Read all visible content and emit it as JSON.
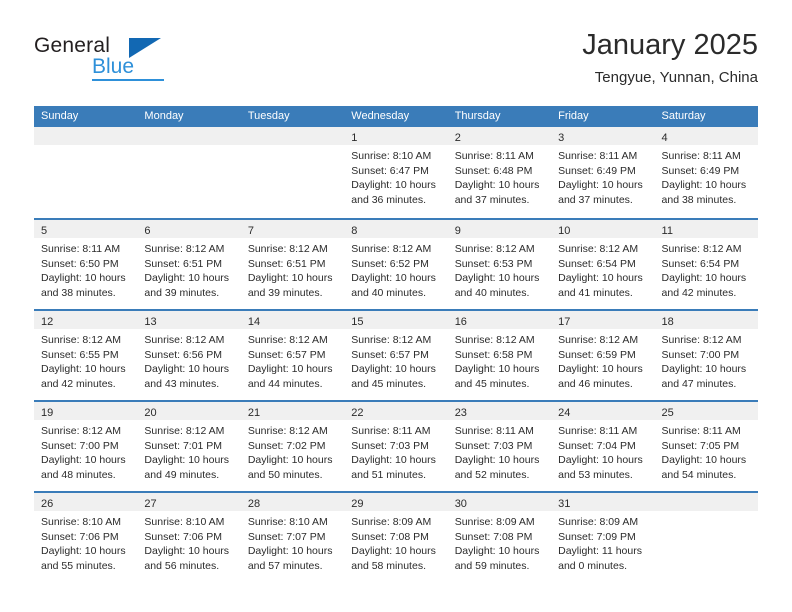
{
  "brand": {
    "name_part1": "General",
    "name_part2": "Blue",
    "triangle_icon": "triangle-icon",
    "accent_color": "#2e90d9",
    "triangle_color": "#1268b3"
  },
  "header": {
    "month_title": "January 2025",
    "location": "Tengyue, Yunnan, China",
    "header_bg_color": "#3a7cb9",
    "day_strip_color": "#f0f0f0"
  },
  "weekdays": [
    "Sunday",
    "Monday",
    "Tuesday",
    "Wednesday",
    "Thursday",
    "Friday",
    "Saturday"
  ],
  "weeks": [
    [
      {
        "day": "",
        "lines": []
      },
      {
        "day": "",
        "lines": []
      },
      {
        "day": "",
        "lines": []
      },
      {
        "day": "1",
        "lines": [
          "Sunrise: 8:10 AM",
          "Sunset: 6:47 PM",
          "Daylight: 10 hours",
          "and 36 minutes."
        ]
      },
      {
        "day": "2",
        "lines": [
          "Sunrise: 8:11 AM",
          "Sunset: 6:48 PM",
          "Daylight: 10 hours",
          "and 37 minutes."
        ]
      },
      {
        "day": "3",
        "lines": [
          "Sunrise: 8:11 AM",
          "Sunset: 6:49 PM",
          "Daylight: 10 hours",
          "and 37 minutes."
        ]
      },
      {
        "day": "4",
        "lines": [
          "Sunrise: 8:11 AM",
          "Sunset: 6:49 PM",
          "Daylight: 10 hours",
          "and 38 minutes."
        ]
      }
    ],
    [
      {
        "day": "5",
        "lines": [
          "Sunrise: 8:11 AM",
          "Sunset: 6:50 PM",
          "Daylight: 10 hours",
          "and 38 minutes."
        ]
      },
      {
        "day": "6",
        "lines": [
          "Sunrise: 8:12 AM",
          "Sunset: 6:51 PM",
          "Daylight: 10 hours",
          "and 39 minutes."
        ]
      },
      {
        "day": "7",
        "lines": [
          "Sunrise: 8:12 AM",
          "Sunset: 6:51 PM",
          "Daylight: 10 hours",
          "and 39 minutes."
        ]
      },
      {
        "day": "8",
        "lines": [
          "Sunrise: 8:12 AM",
          "Sunset: 6:52 PM",
          "Daylight: 10 hours",
          "and 40 minutes."
        ]
      },
      {
        "day": "9",
        "lines": [
          "Sunrise: 8:12 AM",
          "Sunset: 6:53 PM",
          "Daylight: 10 hours",
          "and 40 minutes."
        ]
      },
      {
        "day": "10",
        "lines": [
          "Sunrise: 8:12 AM",
          "Sunset: 6:54 PM",
          "Daylight: 10 hours",
          "and 41 minutes."
        ]
      },
      {
        "day": "11",
        "lines": [
          "Sunrise: 8:12 AM",
          "Sunset: 6:54 PM",
          "Daylight: 10 hours",
          "and 42 minutes."
        ]
      }
    ],
    [
      {
        "day": "12",
        "lines": [
          "Sunrise: 8:12 AM",
          "Sunset: 6:55 PM",
          "Daylight: 10 hours",
          "and 42 minutes."
        ]
      },
      {
        "day": "13",
        "lines": [
          "Sunrise: 8:12 AM",
          "Sunset: 6:56 PM",
          "Daylight: 10 hours",
          "and 43 minutes."
        ]
      },
      {
        "day": "14",
        "lines": [
          "Sunrise: 8:12 AM",
          "Sunset: 6:57 PM",
          "Daylight: 10 hours",
          "and 44 minutes."
        ]
      },
      {
        "day": "15",
        "lines": [
          "Sunrise: 8:12 AM",
          "Sunset: 6:57 PM",
          "Daylight: 10 hours",
          "and 45 minutes."
        ]
      },
      {
        "day": "16",
        "lines": [
          "Sunrise: 8:12 AM",
          "Sunset: 6:58 PM",
          "Daylight: 10 hours",
          "and 45 minutes."
        ]
      },
      {
        "day": "17",
        "lines": [
          "Sunrise: 8:12 AM",
          "Sunset: 6:59 PM",
          "Daylight: 10 hours",
          "and 46 minutes."
        ]
      },
      {
        "day": "18",
        "lines": [
          "Sunrise: 8:12 AM",
          "Sunset: 7:00 PM",
          "Daylight: 10 hours",
          "and 47 minutes."
        ]
      }
    ],
    [
      {
        "day": "19",
        "lines": [
          "Sunrise: 8:12 AM",
          "Sunset: 7:00 PM",
          "Daylight: 10 hours",
          "and 48 minutes."
        ]
      },
      {
        "day": "20",
        "lines": [
          "Sunrise: 8:12 AM",
          "Sunset: 7:01 PM",
          "Daylight: 10 hours",
          "and 49 minutes."
        ]
      },
      {
        "day": "21",
        "lines": [
          "Sunrise: 8:12 AM",
          "Sunset: 7:02 PM",
          "Daylight: 10 hours",
          "and 50 minutes."
        ]
      },
      {
        "day": "22",
        "lines": [
          "Sunrise: 8:11 AM",
          "Sunset: 7:03 PM",
          "Daylight: 10 hours",
          "and 51 minutes."
        ]
      },
      {
        "day": "23",
        "lines": [
          "Sunrise: 8:11 AM",
          "Sunset: 7:03 PM",
          "Daylight: 10 hours",
          "and 52 minutes."
        ]
      },
      {
        "day": "24",
        "lines": [
          "Sunrise: 8:11 AM",
          "Sunset: 7:04 PM",
          "Daylight: 10 hours",
          "and 53 minutes."
        ]
      },
      {
        "day": "25",
        "lines": [
          "Sunrise: 8:11 AM",
          "Sunset: 7:05 PM",
          "Daylight: 10 hours",
          "and 54 minutes."
        ]
      }
    ],
    [
      {
        "day": "26",
        "lines": [
          "Sunrise: 8:10 AM",
          "Sunset: 7:06 PM",
          "Daylight: 10 hours",
          "and 55 minutes."
        ]
      },
      {
        "day": "27",
        "lines": [
          "Sunrise: 8:10 AM",
          "Sunset: 7:06 PM",
          "Daylight: 10 hours",
          "and 56 minutes."
        ]
      },
      {
        "day": "28",
        "lines": [
          "Sunrise: 8:10 AM",
          "Sunset: 7:07 PM",
          "Daylight: 10 hours",
          "and 57 minutes."
        ]
      },
      {
        "day": "29",
        "lines": [
          "Sunrise: 8:09 AM",
          "Sunset: 7:08 PM",
          "Daylight: 10 hours",
          "and 58 minutes."
        ]
      },
      {
        "day": "30",
        "lines": [
          "Sunrise: 8:09 AM",
          "Sunset: 7:08 PM",
          "Daylight: 10 hours",
          "and 59 minutes."
        ]
      },
      {
        "day": "31",
        "lines": [
          "Sunrise: 8:09 AM",
          "Sunset: 7:09 PM",
          "Daylight: 11 hours",
          "and 0 minutes."
        ]
      },
      {
        "day": "",
        "lines": []
      }
    ]
  ]
}
